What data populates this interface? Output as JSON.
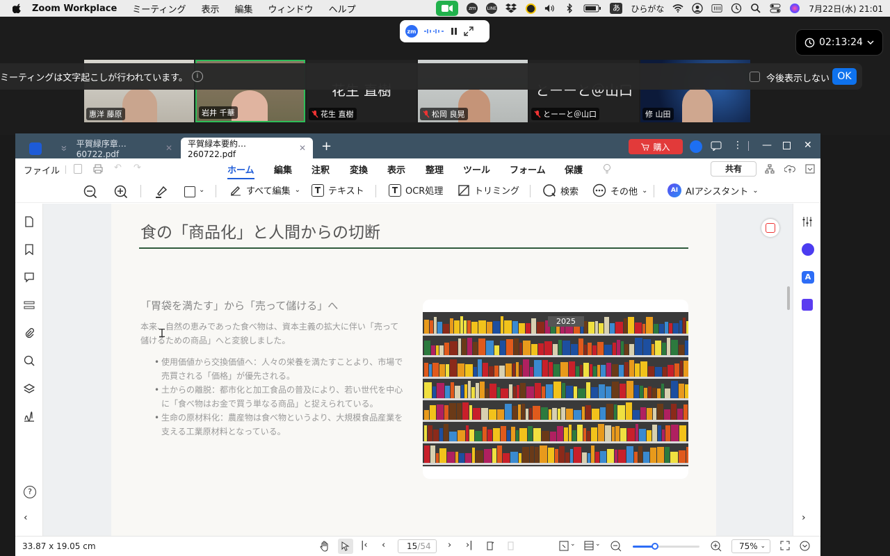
{
  "menubar": {
    "app_name": "Zoom Workplace",
    "menus": [
      "ミーティング",
      "表示",
      "編集",
      "ウィンドウ",
      "ヘルプ"
    ],
    "ime_label": "ひらがな",
    "ime_icon": "あ",
    "zm_label": "zm",
    "clock": "7月22日(水)  21:01"
  },
  "zoom": {
    "recording_pill": {
      "logo": "zm"
    },
    "timer": "02:13:24",
    "participants": [
      {
        "name": "惠洋 藤原",
        "muted": false,
        "video": true
      },
      {
        "name": "岩井 千華",
        "muted": false,
        "video": true,
        "active": true
      },
      {
        "name": "花生 直樹",
        "muted": true,
        "video": false,
        "big_name": "花生 直樹"
      },
      {
        "name": "松岡 良晃",
        "muted": true,
        "video": true
      },
      {
        "name": "とーーと＠山口",
        "muted": true,
        "video": false,
        "big_name": "とーーと＠山口"
      },
      {
        "name": "修 山田",
        "muted": false,
        "video": true
      }
    ],
    "banner": {
      "text": "ミーティングは文字起こしが行われています。",
      "info_icon": "i",
      "checkbox_label": "今後表示しない",
      "ok_label": "OK"
    }
  },
  "pdf": {
    "tabs": [
      {
        "title": "平賀緑序章…60722.pdf",
        "active": false
      },
      {
        "title": "平賀緑本要約…260722.pdf",
        "active": true
      }
    ],
    "buy_label": "購入",
    "menu": {
      "file": "ファイル",
      "items": [
        "ホーム",
        "編集",
        "注釈",
        "変換",
        "表示",
        "整理",
        "ツール",
        "フォーム",
        "保護"
      ],
      "active_index": 0,
      "share": "共有"
    },
    "tools": {
      "edit_all": "すべて編集",
      "text": "テキスト",
      "ocr": "OCR処理",
      "crop": "トリミング",
      "search": "検索",
      "more": "その他",
      "ai": "AIアシスタント",
      "ai_badge": "AI"
    },
    "page": {
      "title": "食の「商品化」と人間からの切断",
      "heading": "「胃袋を満たす」から「売って儲ける」へ",
      "body": "本来、自然の恵みであった食べ物は、資本主義の拡大に伴い「売って儲けるための商品」へと変貌しました。",
      "bullets": [
        "使用価値から交換価値へ：人々の栄養を満たすことより、市場で売買される「価格」が優先される。",
        "土からの離脱：都市化と加工食品の普及により、若い世代を中心に「食べ物はお金で買う単なる商品」と捉えられている。",
        "生命の原材料化：農産物は食べ物というより、大規模食品産業を支える工業原材料となっている。"
      ],
      "photo_label": "2025",
      "help_icon": "?"
    },
    "status": {
      "dimensions": "33.87 x 19.05 cm",
      "current_page": "15",
      "total_pages": "/54",
      "zoom": "75%",
      "zoom_fraction": 0.33
    }
  }
}
